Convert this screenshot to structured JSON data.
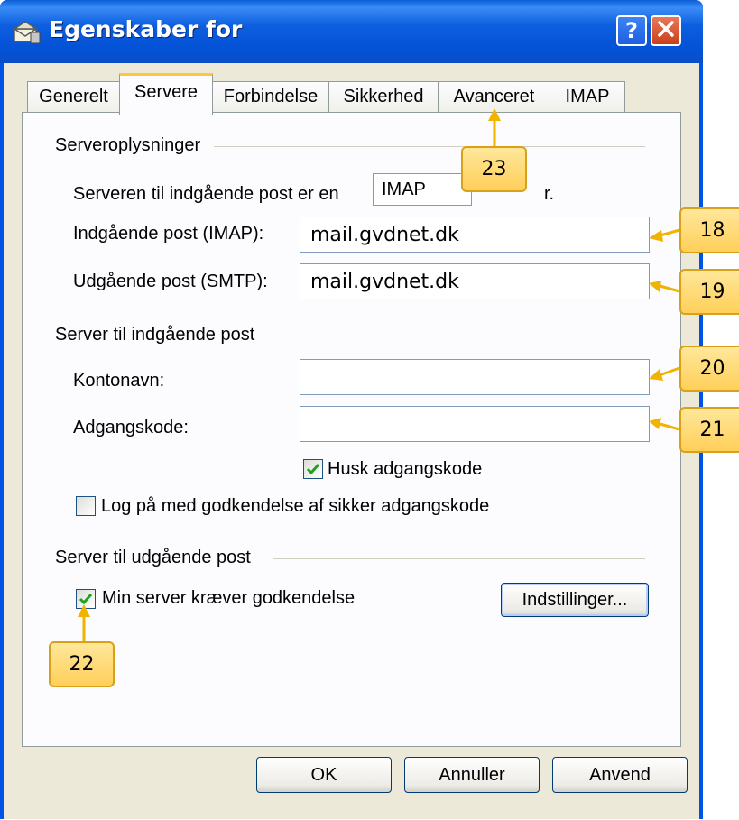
{
  "window": {
    "title": "Egenskaber for",
    "help_label": "?",
    "close_icon": "close-icon"
  },
  "tabs": [
    {
      "label": "Generelt",
      "active": false
    },
    {
      "label": "Servere",
      "active": true
    },
    {
      "label": "Forbindelse",
      "active": false
    },
    {
      "label": "Sikkerhed",
      "active": false
    },
    {
      "label": "Avanceret",
      "active": false
    },
    {
      "label": "IMAP",
      "active": false
    }
  ],
  "server_info": {
    "group_label": "Serveroplysninger",
    "incoming_type_prefix": "Serveren til indgående post er en",
    "incoming_type_value": "IMAP",
    "incoming_type_suffix": "r.",
    "incoming_label": "Indgående post (IMAP):",
    "incoming_value": "mail.gvdnet.dk",
    "outgoing_label": "Udgående post (SMTP):",
    "outgoing_value": "mail.gvdnet.dk"
  },
  "incoming_server": {
    "group_label": "Server til indgående post",
    "account_label": "Kontonavn:",
    "account_value": "",
    "password_label": "Adgangskode:",
    "password_value": "",
    "remember_label": "Husk adgangskode",
    "remember_checked": true,
    "spa_label": "Log på med godkendelse af sikker adgangskode",
    "spa_checked": false
  },
  "outgoing_server": {
    "group_label": "Server til udgående post",
    "auth_label": "Min server kræver godkendelse",
    "auth_checked": true,
    "settings_button": "Indstillinger..."
  },
  "buttons": {
    "ok": "OK",
    "cancel": "Annuller",
    "apply": "Anvend"
  },
  "callouts": {
    "c18": "18",
    "c19": "19",
    "c20": "20",
    "c21": "21",
    "c22": "22",
    "c23": "23"
  },
  "colors": {
    "titlebar": "#0054e3",
    "dialog_face": "#ece9d8",
    "callout_fill": "#ffd766",
    "callout_arrow": "#f0b400",
    "checkmark": "#21a121"
  }
}
